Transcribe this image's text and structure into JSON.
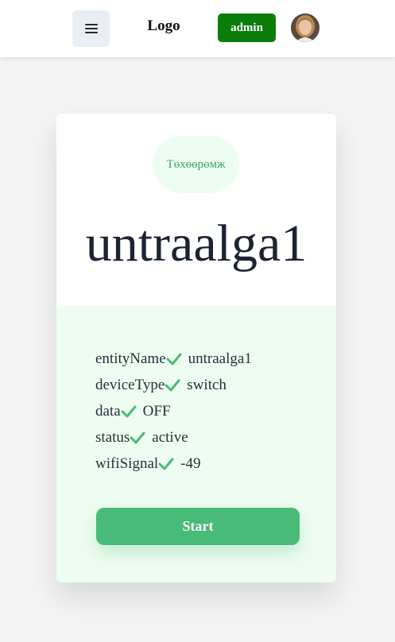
{
  "header": {
    "logo_text": "Logo",
    "admin_label": "admin",
    "menu_icon": "hamburger-menu-icon",
    "avatar_icon": "user-avatar"
  },
  "card": {
    "badge": "Төхөөрөмж",
    "device_name": "untraalga1",
    "properties": [
      {
        "key": "entityName",
        "value": "untraalga1"
      },
      {
        "key": "deviceType",
        "value": "switch"
      },
      {
        "key": "data",
        "value": "OFF"
      },
      {
        "key": "status",
        "value": "active"
      },
      {
        "key": "wifiSignal",
        "value": "-49"
      }
    ],
    "start_label": "Start"
  },
  "colors": {
    "accent_green": "#48bb78",
    "admin_green": "#0b7d0b",
    "panel_bg": "#edfdf1",
    "title_text": "#1c2333"
  }
}
